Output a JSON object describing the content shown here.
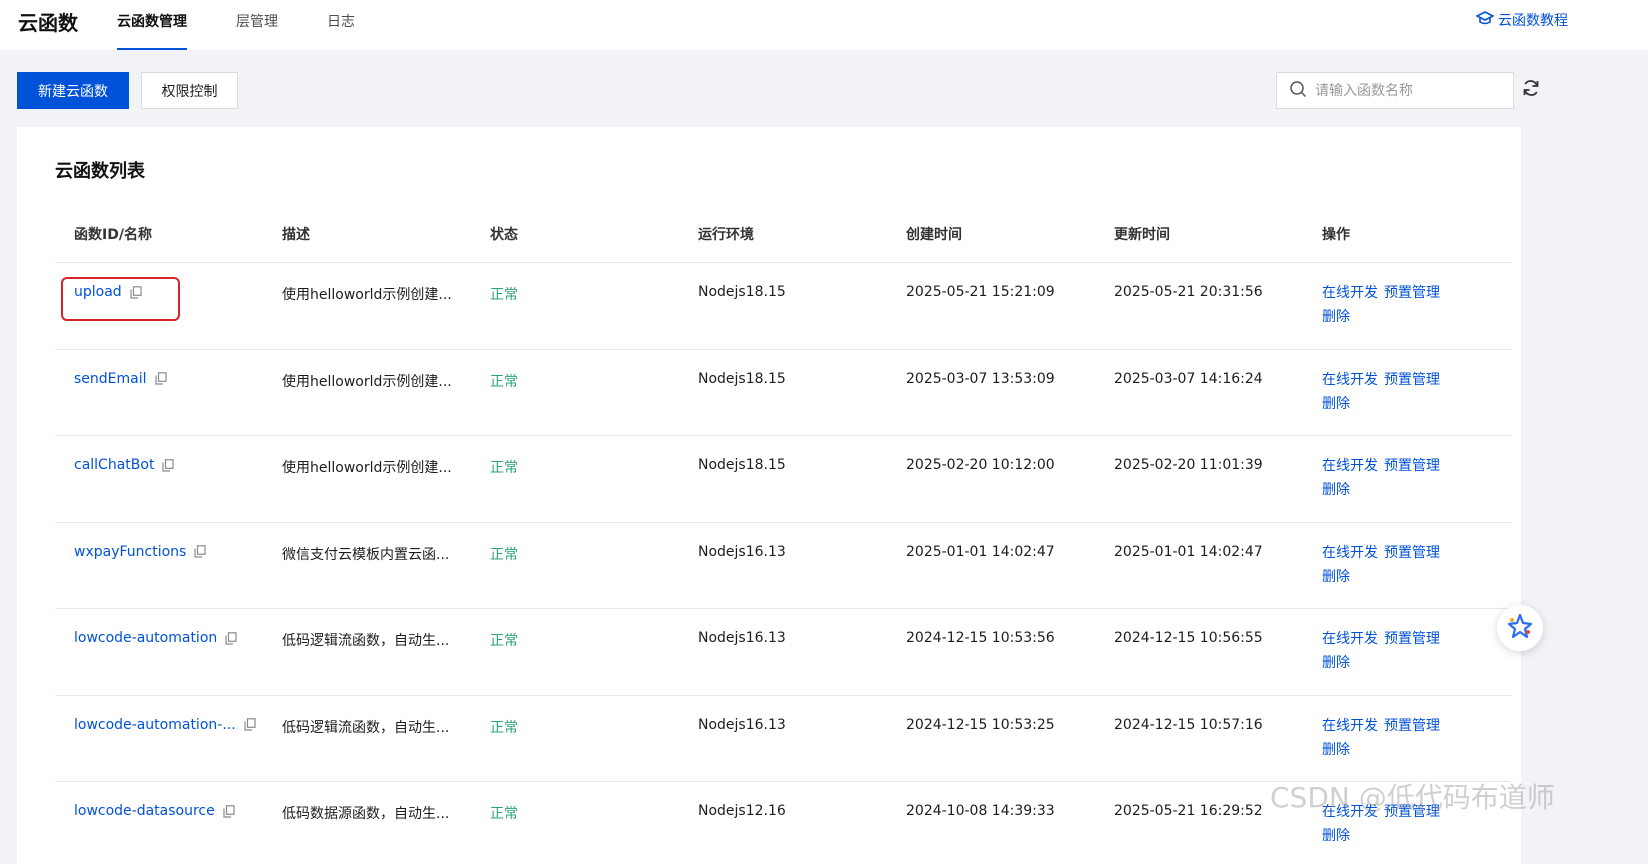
{
  "header": {
    "app_title": "云函数",
    "tabs": [
      {
        "label": "云函数管理",
        "active": true
      },
      {
        "label": "层管理",
        "active": false
      },
      {
        "label": "日志",
        "active": false
      }
    ],
    "tutorial_link": "云函数教程"
  },
  "toolbar": {
    "create_label": "新建云函数",
    "permission_label": "权限控制",
    "search_placeholder": "请输入函数名称",
    "search_value": ""
  },
  "panel": {
    "title": "云函数列表",
    "columns": [
      "函数ID/名称",
      "描述",
      "状态",
      "运行环境",
      "创建时间",
      "更新时间",
      "操作"
    ],
    "rows": [
      {
        "name": "upload",
        "desc": "使用helloworld示例创建...",
        "status": "正常",
        "runtime": "Nodejs18.15",
        "created": "2025-05-21 15:21:09",
        "updated": "2025-05-21 20:31:56"
      },
      {
        "name": "sendEmail",
        "desc": "使用helloworld示例创建...",
        "status": "正常",
        "runtime": "Nodejs18.15",
        "created": "2025-03-07 13:53:09",
        "updated": "2025-03-07 14:16:24"
      },
      {
        "name": "callChatBot",
        "desc": "使用helloworld示例创建...",
        "status": "正常",
        "runtime": "Nodejs18.15",
        "created": "2025-02-20 10:12:00",
        "updated": "2025-02-20 11:01:39"
      },
      {
        "name": "wxpayFunctions",
        "desc": "微信支付云模板内置云函...",
        "status": "正常",
        "runtime": "Nodejs16.13",
        "created": "2025-01-01 14:02:47",
        "updated": "2025-01-01 14:02:47"
      },
      {
        "name": "lowcode-automation",
        "desc": "低码逻辑流函数，自动生...",
        "status": "正常",
        "runtime": "Nodejs16.13",
        "created": "2024-12-15 10:53:56",
        "updated": "2024-12-15 10:56:55"
      },
      {
        "name": "lowcode-automation-...",
        "desc": "低码逻辑流函数，自动生...",
        "status": "正常",
        "runtime": "Nodejs16.13",
        "created": "2024-12-15 10:53:25",
        "updated": "2024-12-15 10:57:16"
      },
      {
        "name": "lowcode-datasource",
        "desc": "低码数据源函数，自动生...",
        "status": "正常",
        "runtime": "Nodejs12.16",
        "created": "2024-10-08 14:39:33",
        "updated": "2025-05-21 16:29:52"
      }
    ],
    "ops": {
      "dev": "在线开发",
      "provision": "预置管理",
      "delete": "删除"
    }
  },
  "watermark": "CSDN @低代码布道师",
  "colors": {
    "primary": "#0052d9",
    "success": "#2ba471",
    "highlight": "#d9232a"
  }
}
